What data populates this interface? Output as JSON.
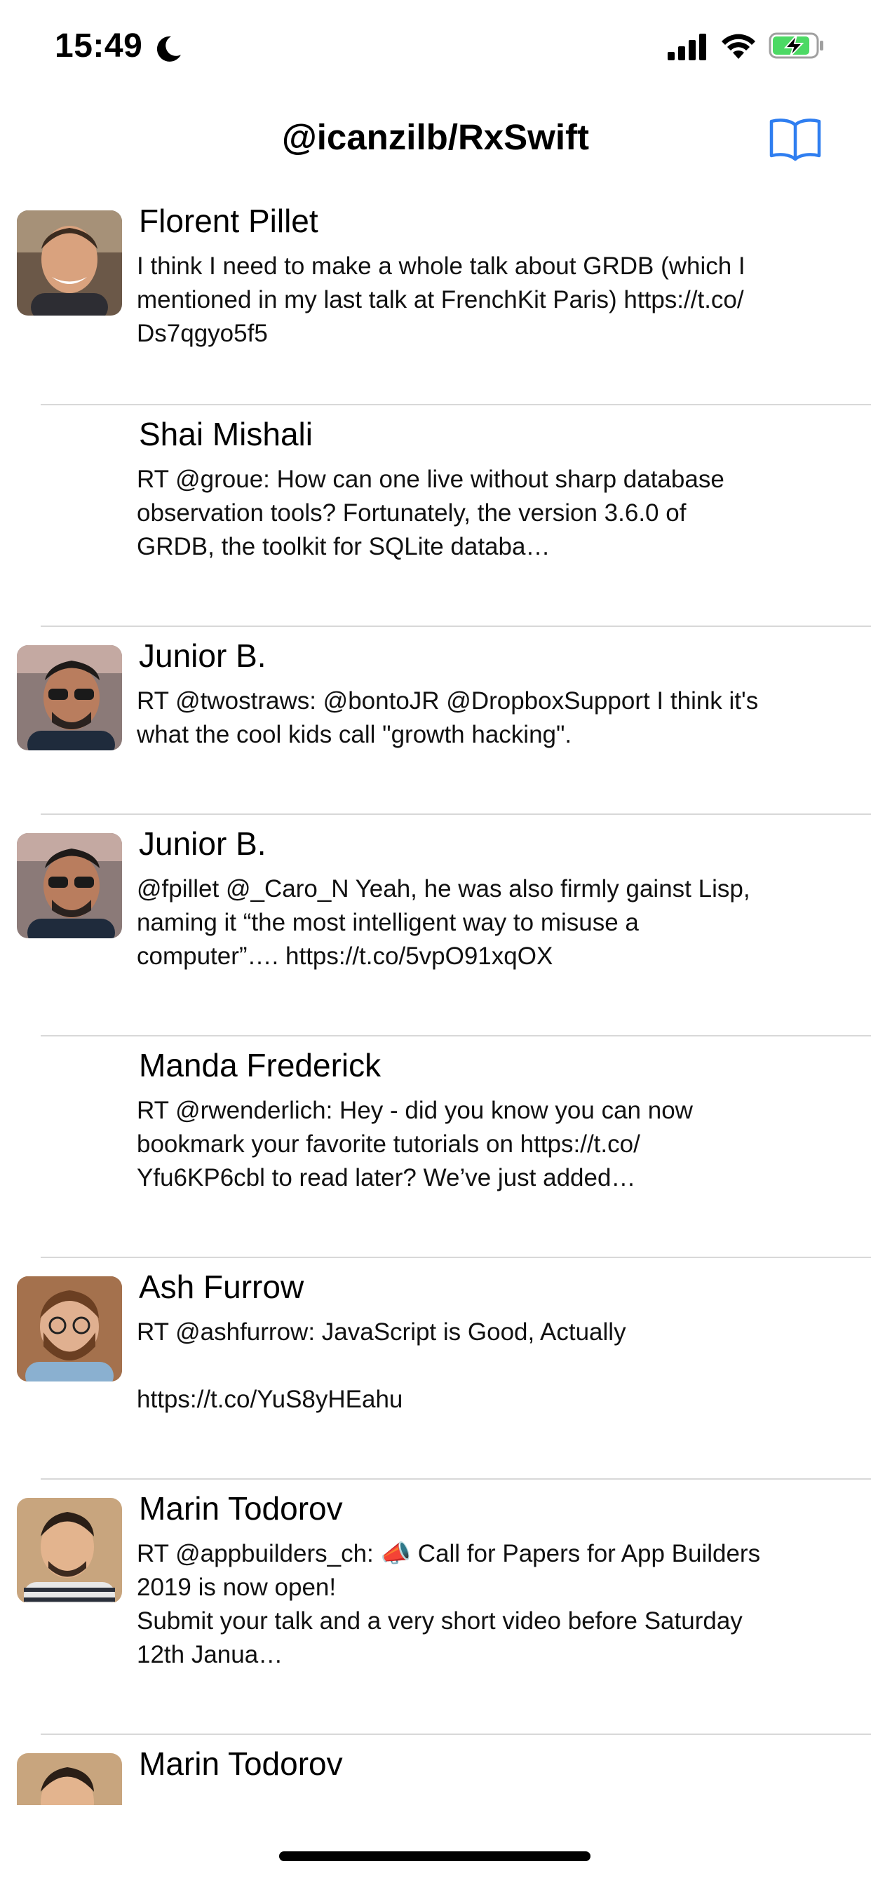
{
  "status_bar": {
    "time": "15:49",
    "icons": [
      "moon-icon",
      "cellular-signal-icon",
      "wifi-icon",
      "battery-charging-icon"
    ],
    "battery_color": "#4cd964"
  },
  "nav": {
    "title": "@icanzilb/RxSwift",
    "right_icon": "book-icon",
    "accent_color": "#2f7ef0"
  },
  "tweets": [
    {
      "name": "Florent Pillet",
      "text": "I think I need to make a whole talk about GRDB (which I\nmentioned in my last talk at FrenchKit Paris) https://t.co/\nDs7qgyo5f5",
      "has_avatar": true
    },
    {
      "name": "Shai Mishali",
      "text": "RT @groue: How can one live without sharp database\nobservation tools? Fortunately, the version 3.6.0 of\nGRDB, the toolkit for SQLite databa…",
      "has_avatar": false
    },
    {
      "name": "Junior B.",
      "text": "RT @twostraws: @bontoJR @DropboxSupport I think it's\nwhat the cool kids call \"growth hacking\".",
      "has_avatar": true
    },
    {
      "name": "Junior B.",
      "text": "@fpillet @_Caro_N Yeah, he was also firmly gainst Lisp,\nnaming it “the most intelligent way to misuse a\ncomputer”…. https://t.co/5vpO91xqOX",
      "has_avatar": true
    },
    {
      "name": "Manda Frederick",
      "text": "RT @rwenderlich: Hey - did you know you can now\nbookmark your favorite tutorials on https://t.co/\nYfu6KP6cbl to read later? We’ve just added…",
      "has_avatar": false
    },
    {
      "name": "Ash Furrow",
      "text": "RT @ashfurrow: JavaScript is Good, Actually\n\nhttps://t.co/YuS8yHEahu",
      "has_avatar": true
    },
    {
      "name": "Marin Todorov",
      "text": "RT @appbuilders_ch: 📣 Call for Papers for App Builders\n2019 is now open!\nSubmit your talk and a very short video before Saturday\n12th Janua…",
      "has_avatar": true
    },
    {
      "name": "Marin Todorov",
      "text": "",
      "has_avatar": true
    }
  ]
}
